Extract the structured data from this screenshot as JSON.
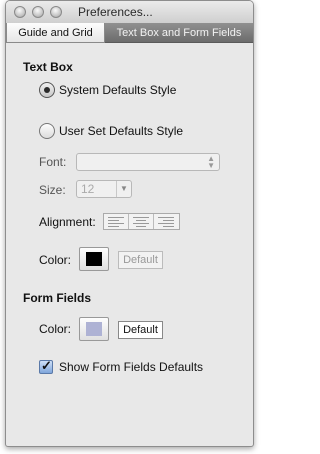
{
  "window": {
    "title": "Preferences..."
  },
  "tabs": [
    {
      "label": "Guide and Grid",
      "active": true
    },
    {
      "label": "Text Box and Form Fields",
      "active": false
    }
  ],
  "text_box": {
    "heading": "Text Box",
    "option_system": "System Defaults Style",
    "option_user": "User Set Defaults Style",
    "selected": "System Defaults Style",
    "font_label": "Font:",
    "font_value": "",
    "size_label": "Size:",
    "size_value": "12",
    "alignment_label": "Alignment:",
    "alignment_options": [
      "left",
      "center",
      "right"
    ],
    "color_label": "Color:",
    "color_swatch": "#000000",
    "default_button": "Default"
  },
  "form_fields": {
    "heading": "Form Fields",
    "color_label": "Color:",
    "color_swatch": "#aeb2d4",
    "default_button": "Default",
    "checkbox_label": "Show Form Fields Defaults",
    "checkbox_checked": true
  }
}
